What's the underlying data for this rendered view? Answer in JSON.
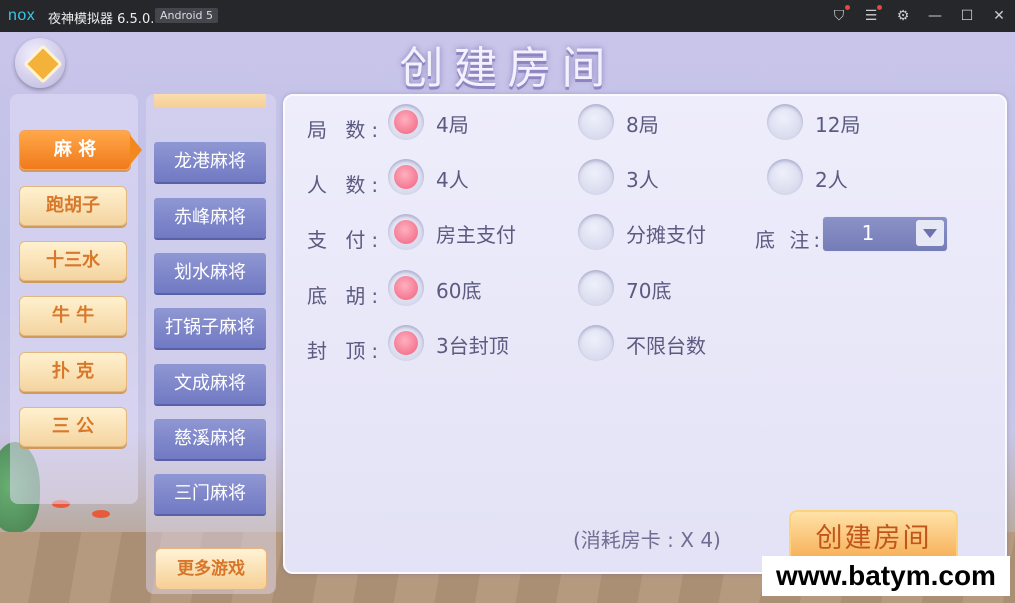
{
  "window": {
    "logo": "nox",
    "app_title": "夜神模拟器 6.5.0.0",
    "android_badge": "Android 5",
    "icons": [
      "shirt-icon",
      "menu-icon",
      "gear-icon",
      "minimize-icon",
      "maximize-icon",
      "close-icon"
    ]
  },
  "screen": {
    "title": "创建房间",
    "categories": [
      "麻 将",
      "跑胡子",
      "十三水",
      "牛 牛",
      "扑 克",
      "三 公"
    ],
    "active_category": "麻 将",
    "games": [
      "龙港麻将",
      "赤峰麻将",
      "划水麻将",
      "打锅子麻将",
      "文成麻将",
      "慈溪麻将",
      "三门麻将"
    ],
    "more_games": "更多游戏",
    "rows": {
      "rounds": {
        "label": "局 数:",
        "options": [
          "4局",
          "8局",
          "12局"
        ],
        "selected": "4局"
      },
      "players": {
        "label": "人 数:",
        "options": [
          "4人",
          "3人",
          "2人"
        ],
        "selected": "4人"
      },
      "payment": {
        "label": "支 付:",
        "options": [
          "房主支付",
          "分摊支付"
        ],
        "selected": "房主支付"
      },
      "base_hu": {
        "label": "底 胡:",
        "options": [
          "60底",
          "70底"
        ],
        "selected": "60底"
      },
      "cap": {
        "label": "封 顶:",
        "options": [
          "3台封顶",
          "不限台数"
        ],
        "selected": "3台封顶"
      }
    },
    "base_bet": {
      "label": "底 注:",
      "value": "1"
    },
    "cost_text": "(消耗房卡 : X 4)",
    "create_button": "创建房间"
  },
  "watermark": "www.batym.com",
  "colors": {
    "accent": "#f07a1c",
    "selected_radio": "#f0607e",
    "game_item": "#7179c3"
  }
}
